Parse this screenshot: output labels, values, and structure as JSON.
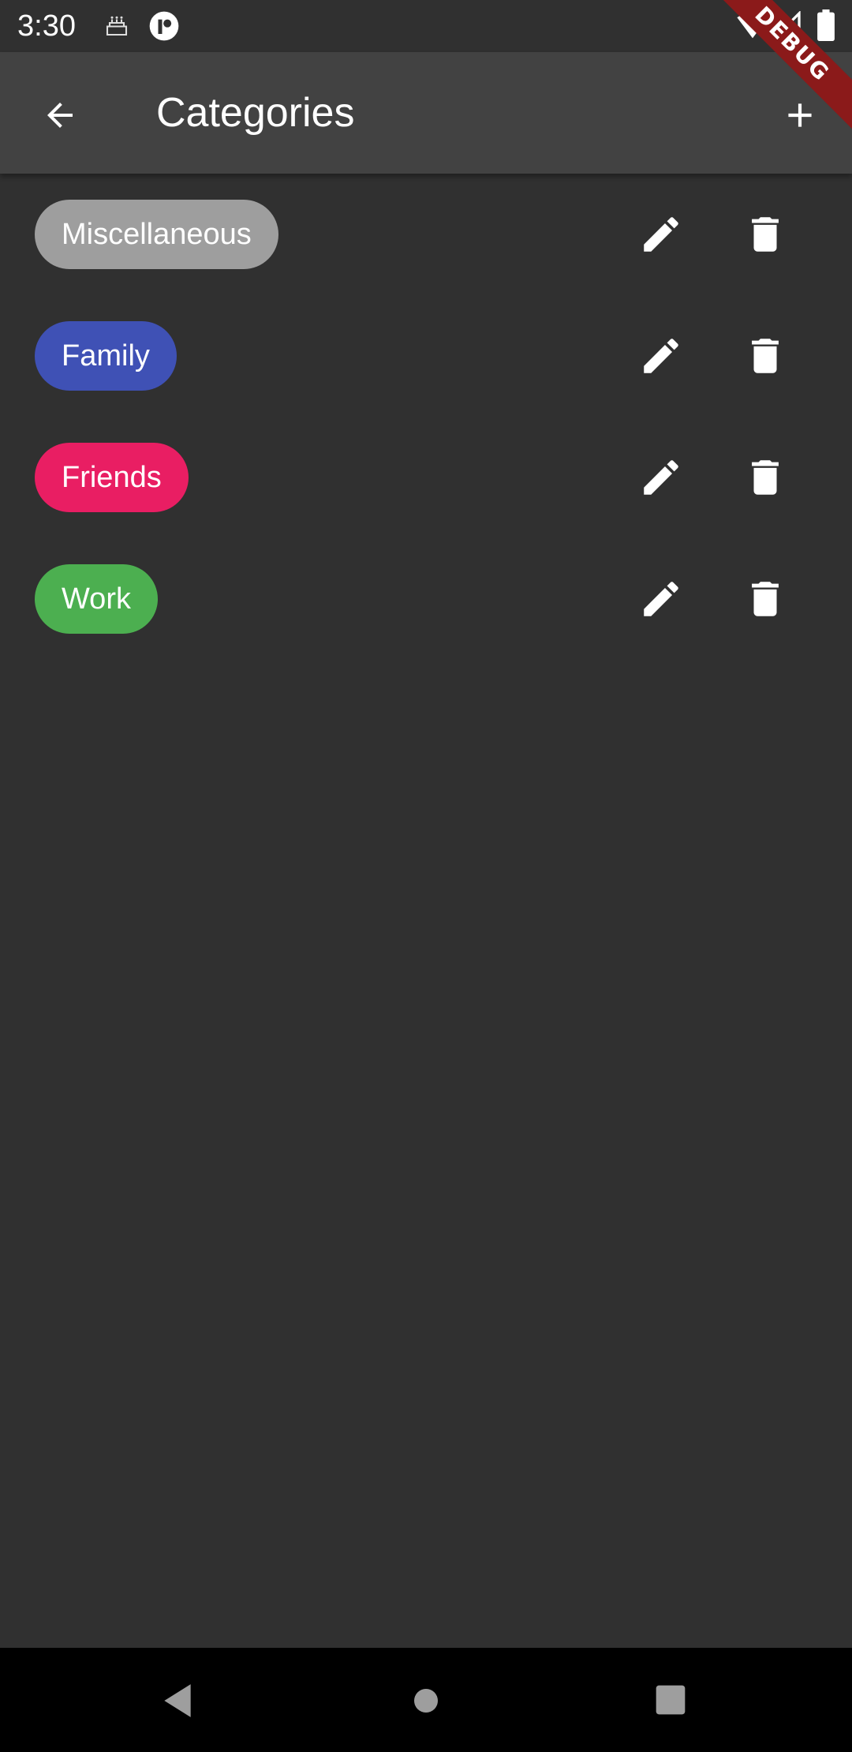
{
  "status_bar": {
    "time": "3:30",
    "icons": [
      "cake-icon",
      "app-notification-icon",
      "wifi-icon",
      "signal-icon",
      "battery-icon"
    ]
  },
  "app_bar": {
    "title": "Categories",
    "back_icon": "arrow-back-icon",
    "add_icon": "add-icon",
    "background": "#424242"
  },
  "debug_banner": {
    "label": "DEBUG",
    "color": "#8b1a1a"
  },
  "categories": [
    {
      "label": "Miscellaneous",
      "color": "#9e9e9e"
    },
    {
      "label": "Family",
      "color": "#3f51b5"
    },
    {
      "label": "Friends",
      "color": "#e91e63"
    },
    {
      "label": "Work",
      "color": "#4caf50"
    }
  ],
  "row_actions": {
    "edit_icon": "pencil-icon",
    "delete_icon": "trash-icon"
  },
  "nav_bar": {
    "icons": [
      "nav-back-icon",
      "nav-home-icon",
      "nav-recents-icon"
    ]
  },
  "colors": {
    "background": "#303030",
    "icon": "#ffffff"
  }
}
